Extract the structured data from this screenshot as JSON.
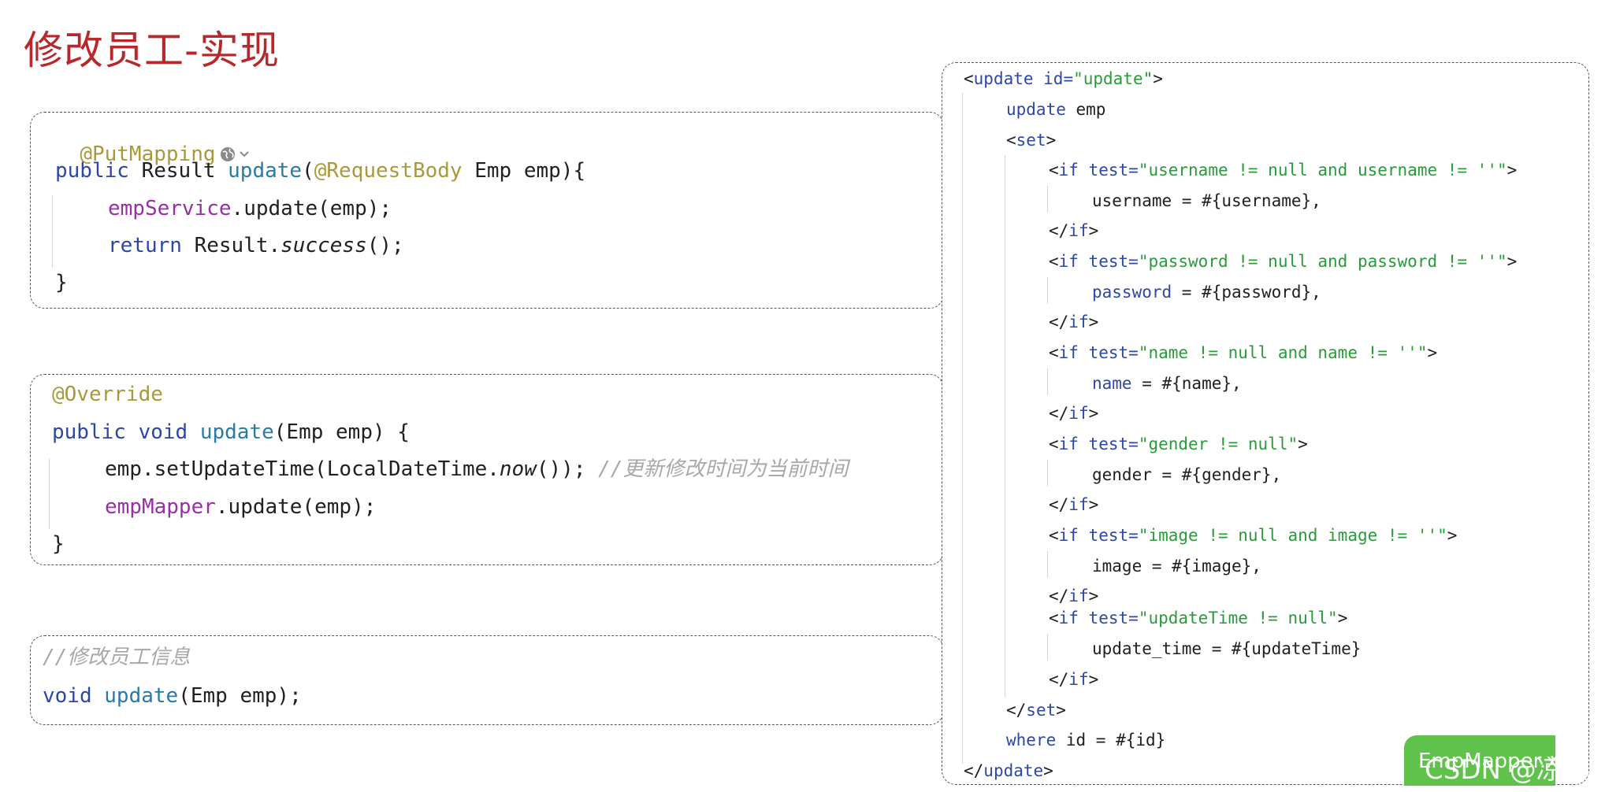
{
  "title": "修改员工-实现",
  "controller": {
    "l1_ann": "@PutMapping",
    "l2": {
      "kw": "public",
      "type": " Result ",
      "fn": "update",
      "p1": "(",
      "ann": "@RequestBody",
      "p2": " Emp emp){"
    },
    "l3": {
      "field": "empService",
      "rest": ".update(emp);"
    },
    "l4": {
      "kw": "return",
      "pre": " Result.",
      "it": "success",
      "post": "();"
    },
    "l5": "}"
  },
  "service": {
    "l1_ann": "@Override",
    "l2": {
      "kw": "public void",
      "fn": "update",
      "rest": "(Emp emp) {"
    },
    "l3": {
      "pre": "emp.setUpdateTime(LocalDateTime.",
      "it": "now",
      "post": "()); ",
      "cmt": "//更新修改时间为当前时间"
    },
    "l4": {
      "field": "empMapper",
      "rest": ".update(emp);"
    },
    "l5": "}"
  },
  "mapper": {
    "l1_cmt": "//修改员工信息",
    "l2": {
      "kw": "void",
      "fn": "update",
      "rest": "(Emp emp);"
    }
  },
  "xml": {
    "update_open": {
      "lt": "<",
      "tag": "update",
      "attr": " id=",
      "val": "\"update\"",
      "gt": ">"
    },
    "update_stmt": {
      "kw": "update",
      "rest": " emp"
    },
    "set_open": {
      "lt": "<",
      "tag": "set",
      "gt": ">"
    },
    "if_username": {
      "lt": "<",
      "tag": "if",
      "attr": " test=",
      "val": "\"username != null and username != ''\"",
      "gt": ">"
    },
    "set_username": "username = #{username},",
    "if_close_1": {
      "lt": "</",
      "tag": "if",
      "gt": ">"
    },
    "if_password": {
      "lt": "<",
      "tag": "if",
      "attr": " test=",
      "val": "\"password != null and password != ''\"",
      "gt": ">"
    },
    "set_password": {
      "kw": "password",
      "rest": " = #{password},"
    },
    "if_close_2": {
      "lt": "</",
      "tag": "if",
      "gt": ">"
    },
    "if_name": {
      "lt": "<",
      "tag": "if",
      "attr": " test=",
      "val": "\"name != null and name != ''\"",
      "gt": ">"
    },
    "set_name": {
      "kw": "name",
      "rest": " = #{name},"
    },
    "if_close_3": {
      "lt": "</",
      "tag": "if",
      "gt": ">"
    },
    "if_gender": {
      "lt": "<",
      "tag": "if",
      "attr": " test=",
      "val": "\"gender != null\"",
      "gt": ">"
    },
    "set_gender": "gender = #{gender},",
    "if_close_4": {
      "lt": "</",
      "tag": "if",
      "gt": ">"
    },
    "if_image": {
      "lt": "<",
      "tag": "if",
      "attr": " test=",
      "val": "\"image != null and image != ''\"",
      "gt": ">"
    },
    "set_image": "image = #{image},",
    "if_close_5": {
      "lt": "</",
      "tag": "if",
      "gt": ">"
    },
    "if_updatetime": {
      "lt": "<",
      "tag": "if",
      "attr": " test=",
      "val": "\"updateTime != null\"",
      "gt": ">"
    },
    "set_updatetime": "update_time = #{updateTime}",
    "if_close_6": {
      "lt": "</",
      "tag": "if",
      "gt": ">"
    },
    "set_close": {
      "lt": "</",
      "tag": "set",
      "gt": ">"
    },
    "where": {
      "kw": "where",
      "rest": " id = #{id}"
    },
    "update_close": {
      "lt": "</",
      "tag": "update",
      "gt": ">"
    }
  },
  "badge": "EmpMapper.xml",
  "watermark": "CSDN @凉漠",
  "colors": {
    "title": "#b8282a",
    "keyword": "#2d47a8",
    "annotation": "#a89a3a",
    "field": "#9a2ea8",
    "string": "#2a9a3a",
    "comment": "#a8a8a8",
    "badge": "#5fc24a"
  },
  "icons": {
    "globe": "globe-icon",
    "chevron": "chevron-down-icon"
  }
}
